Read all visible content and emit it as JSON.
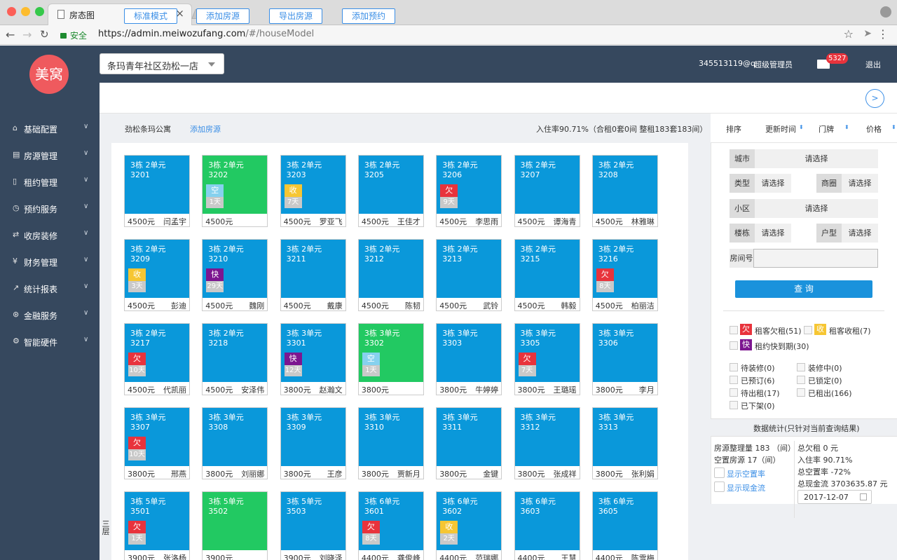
{
  "browser": {
    "tab_title": "房态图",
    "secure_label": "安全",
    "url_host": "https://admin.meiwozufang.com",
    "url_path": "/#/houseModel"
  },
  "header": {
    "logo_text": "美窝",
    "store": "条玛青年社区劲松一店",
    "user": "345513119@q",
    "role": "超级管理员",
    "mail_count": "5327",
    "logout": "退出"
  },
  "sidebar": {
    "items": [
      {
        "label": "基础配置",
        "icon": "home-icon"
      },
      {
        "label": "房源管理",
        "icon": "building-icon"
      },
      {
        "label": "租约管理",
        "icon": "document-icon"
      },
      {
        "label": "预约服务",
        "icon": "clock-icon"
      },
      {
        "label": "收房装修",
        "icon": "shuffle-icon"
      },
      {
        "label": "财务管理",
        "icon": "money-icon"
      },
      {
        "label": "统计报表",
        "icon": "chart-icon"
      },
      {
        "label": "金融服务",
        "icon": "bank-icon"
      },
      {
        "label": "智能硬件",
        "icon": "gear-icon"
      }
    ]
  },
  "toolbar": {
    "buttons": [
      "标准模式",
      "添加房源",
      "导出房源",
      "添加预约"
    ],
    "next_icon": ">"
  },
  "info": {
    "name": "劲松条玛公寓",
    "add_link": "添加房源",
    "rate": "入住率90.71%（合租0套0间 整租183套183间）"
  },
  "floor_label": "三层",
  "colors": {
    "blue": "#0a98da",
    "green": "#22c962",
    "debt": "#e8333c",
    "collect": "#f6c633",
    "soon": "#7c1690",
    "vacant": "#86d1ee"
  },
  "rooms": [
    {
      "unit": "3栋 2单元",
      "no": "3201",
      "price": "4500元",
      "tenant": "闫孟宇",
      "status": "blue",
      "tag": "",
      "days": ""
    },
    {
      "unit": "3栋 2单元",
      "no": "3202",
      "price": "4500元",
      "tenant": "",
      "status": "green",
      "tag": "空",
      "days": "1天"
    },
    {
      "unit": "3栋 2单元",
      "no": "3203",
      "price": "4500元",
      "tenant": "罗亚飞",
      "status": "blue",
      "tag": "收",
      "days": "7天"
    },
    {
      "unit": "3栋 2单元",
      "no": "3205",
      "price": "4500元",
      "tenant": "王佳才",
      "status": "blue",
      "tag": "",
      "days": ""
    },
    {
      "unit": "3栋 2单元",
      "no": "3206",
      "price": "4500元",
      "tenant": "李思雨",
      "status": "blue",
      "tag": "欠",
      "days": "9天"
    },
    {
      "unit": "3栋 2单元",
      "no": "3207",
      "price": "4500元",
      "tenant": "谭海青",
      "status": "blue",
      "tag": "",
      "days": ""
    },
    {
      "unit": "3栋 2单元",
      "no": "3208",
      "price": "4500元",
      "tenant": "林雅琳",
      "status": "blue",
      "tag": "",
      "days": ""
    },
    {
      "unit": "3栋 2单元",
      "no": "3209",
      "price": "4500元",
      "tenant": "彭迪",
      "status": "blue",
      "tag": "收",
      "days": "3天"
    },
    {
      "unit": "3栋 2单元",
      "no": "3210",
      "price": "4500元",
      "tenant": "魏刚",
      "status": "blue",
      "tag": "快",
      "days": "29天"
    },
    {
      "unit": "3栋 2单元",
      "no": "3211",
      "price": "4500元",
      "tenant": "戴康",
      "status": "blue",
      "tag": "",
      "days": ""
    },
    {
      "unit": "3栋 2单元",
      "no": "3212",
      "price": "4500元",
      "tenant": "陈韧",
      "status": "blue",
      "tag": "",
      "days": ""
    },
    {
      "unit": "3栋 2单元",
      "no": "3213",
      "price": "4500元",
      "tenant": "武铃",
      "status": "blue",
      "tag": "",
      "days": ""
    },
    {
      "unit": "3栋 2单元",
      "no": "3215",
      "price": "4500元",
      "tenant": "韩毅",
      "status": "blue",
      "tag": "",
      "days": ""
    },
    {
      "unit": "3栋 2单元",
      "no": "3216",
      "price": "4500元",
      "tenant": "柏丽洁",
      "status": "blue",
      "tag": "欠",
      "days": "8天"
    },
    {
      "unit": "3栋 2单元",
      "no": "3217",
      "price": "4500元",
      "tenant": "代凯丽",
      "status": "blue",
      "tag": "欠",
      "days": "10天"
    },
    {
      "unit": "3栋 2单元",
      "no": "3218",
      "price": "4500元",
      "tenant": "安泽伟",
      "status": "blue",
      "tag": "",
      "days": ""
    },
    {
      "unit": "3栋 3单元",
      "no": "3301",
      "price": "3800元",
      "tenant": "赵瀚文",
      "status": "blue",
      "tag": "快",
      "days": "12天"
    },
    {
      "unit": "3栋 3单元",
      "no": "3302",
      "price": "3800元",
      "tenant": "",
      "status": "green",
      "tag": "空",
      "days": "1天"
    },
    {
      "unit": "3栋 3单元",
      "no": "3303",
      "price": "3800元",
      "tenant": "牛婷婷",
      "status": "blue",
      "tag": "",
      "days": ""
    },
    {
      "unit": "3栋 3单元",
      "no": "3305",
      "price": "3800元",
      "tenant": "王璐瑶",
      "status": "blue",
      "tag": "欠",
      "days": "7天"
    },
    {
      "unit": "3栋 3单元",
      "no": "3306",
      "price": "3800元",
      "tenant": "李月",
      "status": "blue",
      "tag": "",
      "days": ""
    },
    {
      "unit": "3栋 3单元",
      "no": "3307",
      "price": "3800元",
      "tenant": "邢燕",
      "status": "blue",
      "tag": "欠",
      "days": "10天"
    },
    {
      "unit": "3栋 3单元",
      "no": "3308",
      "price": "3800元",
      "tenant": "刘丽娜",
      "status": "blue",
      "tag": "",
      "days": ""
    },
    {
      "unit": "3栋 3单元",
      "no": "3309",
      "price": "3800元",
      "tenant": "王彦",
      "status": "blue",
      "tag": "",
      "days": ""
    },
    {
      "unit": "3栋 3单元",
      "no": "3310",
      "price": "3800元",
      "tenant": "贾新月",
      "status": "blue",
      "tag": "",
      "days": ""
    },
    {
      "unit": "3栋 3单元",
      "no": "3311",
      "price": "3800元",
      "tenant": "金键",
      "status": "blue",
      "tag": "",
      "days": ""
    },
    {
      "unit": "3栋 3单元",
      "no": "3312",
      "price": "3800元",
      "tenant": "张成祥",
      "status": "blue",
      "tag": "",
      "days": ""
    },
    {
      "unit": "3栋 3单元",
      "no": "3313",
      "price": "3800元",
      "tenant": "张利娟",
      "status": "blue",
      "tag": "",
      "days": ""
    },
    {
      "unit": "3栋 5单元",
      "no": "3501",
      "price": "3900元",
      "tenant": "张洛杨",
      "status": "blue",
      "tag": "欠",
      "days": "1天"
    },
    {
      "unit": "3栋 5单元",
      "no": "3502",
      "price": "3900元",
      "tenant": "",
      "status": "green",
      "tag": "",
      "days": ""
    },
    {
      "unit": "3栋 5单元",
      "no": "3503",
      "price": "3900元",
      "tenant": "刘晓泽",
      "status": "blue",
      "tag": "",
      "days": ""
    },
    {
      "unit": "3栋 6单元",
      "no": "3601",
      "price": "4400元",
      "tenant": "龚俊峰",
      "status": "blue",
      "tag": "欠",
      "days": "8天"
    },
    {
      "unit": "3栋 6单元",
      "no": "3602",
      "price": "4400元",
      "tenant": "范瑞娜",
      "status": "blue",
      "tag": "收",
      "days": "2天"
    },
    {
      "unit": "3栋 6单元",
      "no": "3603",
      "price": "4400元",
      "tenant": "王慧",
      "status": "blue",
      "tag": "",
      "days": ""
    },
    {
      "unit": "3栋 6单元",
      "no": "3605",
      "price": "4400元",
      "tenant": "陈雪梅",
      "status": "blue",
      "tag": "",
      "days": ""
    }
  ],
  "sort": {
    "label": "排序",
    "fields": [
      "更新时间",
      "门牌",
      "价格"
    ]
  },
  "filters": {
    "city_label": "城市",
    "type_label": "类型",
    "district_label": "商圈",
    "community_label": "小区",
    "building_label": "楼栋",
    "layout_label": "户型",
    "room_label": "房间号",
    "placeholder": "请选择",
    "query": "查 询"
  },
  "legend": {
    "debt_tag": "欠",
    "debt_label": "租客欠租(51)",
    "collect_tag": "收",
    "collect_label": "租客收租(7)",
    "soon_tag": "快",
    "soon_label": "租约快到期(30)"
  },
  "states": [
    "待装修(0)",
    "装修中(0)",
    "已预订(6)",
    "已锁定(0)",
    "待出租(17)",
    "已租出(166)",
    "已下架(0)"
  ],
  "stats": {
    "title": "数据统计(只针对当前查询结果)",
    "total_label": "房源整理量  183 （间）",
    "vacant_label": "空置房源  17（间）",
    "show_vacancy": "显示空置率",
    "show_cashflow": "显示现金流",
    "debt_total": "总欠租  0 元",
    "occupancy": "入住率  90.71%",
    "vacancy_rate": "总空置率  -72%",
    "cashflow": "总现金流  3703635.87 元",
    "date": "2017-12-07"
  }
}
